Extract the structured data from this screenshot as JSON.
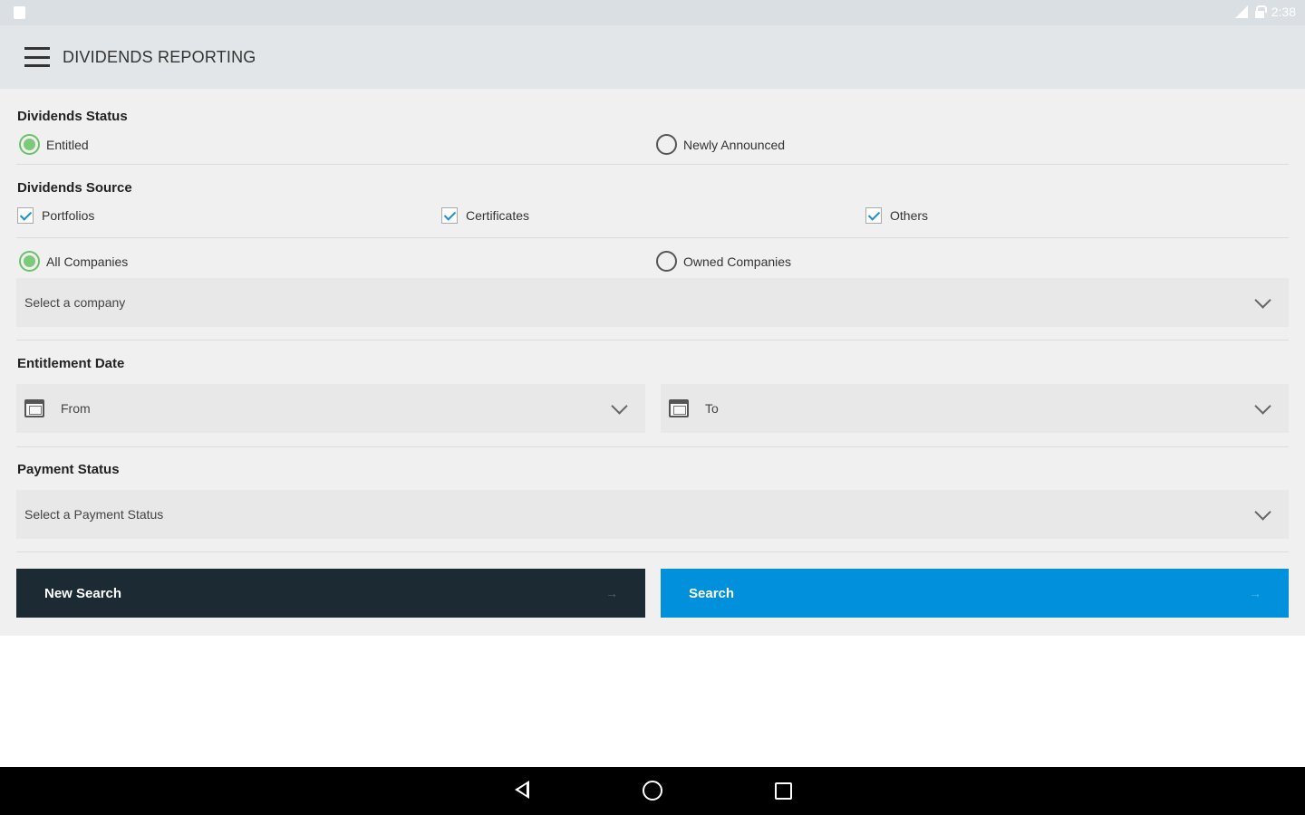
{
  "status_bar": {
    "time": "2:38"
  },
  "app_bar": {
    "title": "DIVIDENDS REPORTING"
  },
  "dividends_status": {
    "title": "Dividends Status",
    "options": [
      {
        "label": "Entitled",
        "selected": true
      },
      {
        "label": "Newly Announced",
        "selected": false
      }
    ]
  },
  "dividends_source": {
    "title": "Dividends Source",
    "checkboxes": [
      {
        "label": "Portfolios",
        "checked": true
      },
      {
        "label": "Certificates",
        "checked": true
      },
      {
        "label": "Others",
        "checked": true
      }
    ],
    "company_scope": [
      {
        "label": "All Companies",
        "selected": true
      },
      {
        "label": "Owned Companies",
        "selected": false
      }
    ],
    "company_select_placeholder": "Select a company"
  },
  "entitlement_date": {
    "title": "Entitlement Date",
    "from_label": "From",
    "to_label": "To"
  },
  "payment_status": {
    "title": "Payment Status",
    "select_placeholder": "Select a Payment Status"
  },
  "buttons": {
    "new_search": "New Search",
    "search": "Search",
    "arrow": "→"
  },
  "colors": {
    "accent_blue": "#0090dc",
    "dark_button": "#1c2a33",
    "radio_selected": "#7dc87b",
    "checkbox_tick": "#1a8fd8"
  },
  "icons": [
    "menu-icon",
    "calendar-icon",
    "chevron-down-icon",
    "arrow-right-icon",
    "back-icon",
    "home-icon",
    "recents-icon",
    "signal-icon",
    "lock-icon"
  ]
}
